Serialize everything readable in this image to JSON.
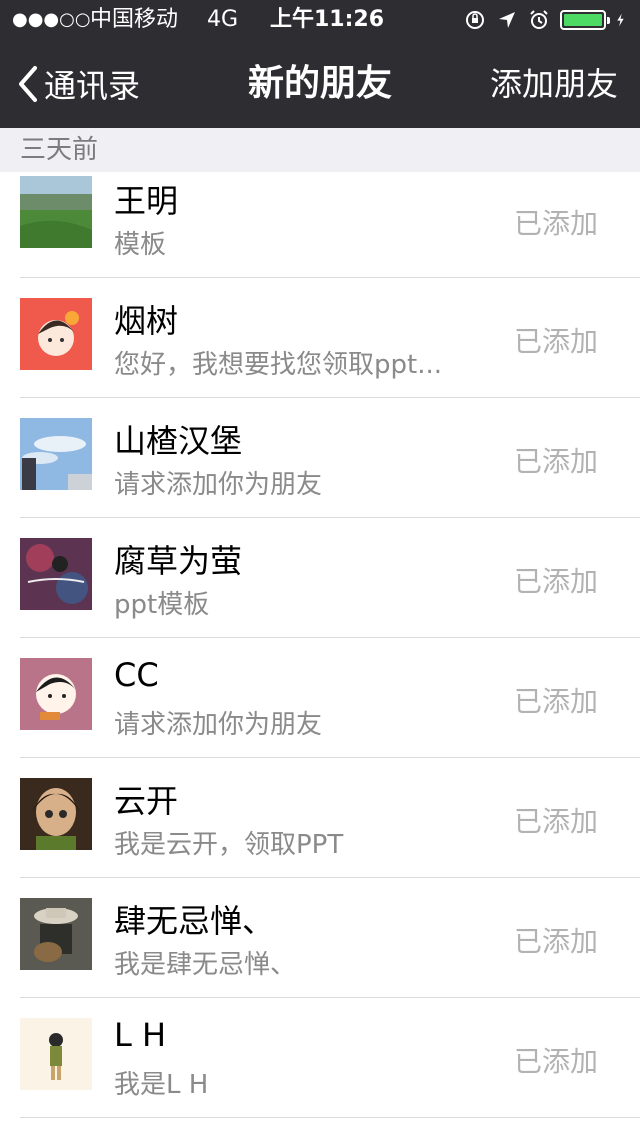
{
  "status_bar": {
    "signal": "●●●○○",
    "carrier": "中国移动",
    "network": "4G",
    "time": "上午11:26"
  },
  "nav": {
    "back_label": "通讯录",
    "title": "新的朋友",
    "action_label": "添加朋友"
  },
  "section_header": "三天前",
  "friends": [
    {
      "name": "王明",
      "message": "模板",
      "status": "已添加"
    },
    {
      "name": "烟树",
      "message": "您好，我想要找您领取ppt...",
      "status": "已添加"
    },
    {
      "name": "山楂汉堡",
      "message": "请求添加你为朋友",
      "status": "已添加"
    },
    {
      "name": "腐草为萤",
      "message": "ppt模板",
      "status": "已添加"
    },
    {
      "name": "CC",
      "message": "请求添加你为朋友",
      "status": "已添加"
    },
    {
      "name": "云开",
      "message": "我是云开，领取PPT",
      "status": "已添加"
    },
    {
      "name": "肆无忌惮、",
      "message": "我是肆无忌惮、",
      "status": "已添加"
    },
    {
      "name": "L H",
      "message": "我是L H",
      "status": "已添加"
    }
  ],
  "colors": {
    "navbar_bg": "#2e2e32",
    "section_bg": "#efeff4",
    "battery": "#4cd964",
    "status_text": "#b2b2b2"
  }
}
